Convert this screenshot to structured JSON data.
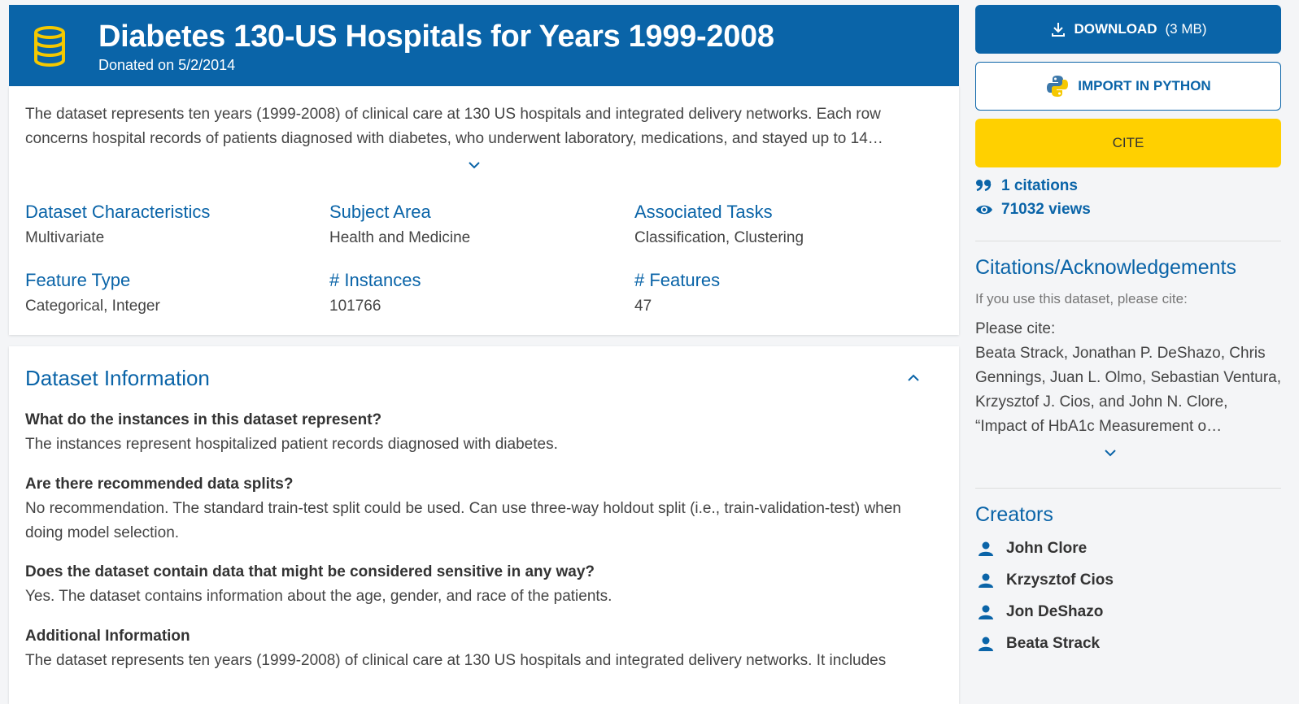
{
  "header": {
    "title": "Diabetes 130-US Hospitals for Years 1999-2008",
    "donated": "Donated on 5/2/2014"
  },
  "summary": {
    "description": "The dataset represents ten years (1999-2008) of clinical care at 130 US hospitals and integrated delivery networks. Each row concerns hospital records of patients diagnosed with diabetes, who underwent laboratory, medications, and stayed up to 14…",
    "characteristics_label": "Dataset Characteristics",
    "characteristics_value": "Multivariate",
    "subject_label": "Subject Area",
    "subject_value": "Health and Medicine",
    "tasks_label": "Associated Tasks",
    "tasks_value": "Classification, Clustering",
    "feature_type_label": "Feature Type",
    "feature_type_value": "Categorical, Integer",
    "instances_label": "# Instances",
    "instances_value": "101766",
    "features_label": "# Features",
    "features_value": "47"
  },
  "info": {
    "heading": "Dataset Information",
    "items": [
      {
        "q": "What do the instances in this dataset represent?",
        "a": "The instances represent hospitalized patient records diagnosed with diabetes."
      },
      {
        "q": "Are there recommended data splits?",
        "a": "No recommendation. The standard train-test split could be used. Can use three-way holdout split (i.e., train-validation-test) when doing model selection."
      },
      {
        "q": "Does the dataset contain data that might be considered sensitive in any way?",
        "a": "Yes. The dataset contains information about the age, gender, and race of the patients."
      },
      {
        "q": "Additional Information",
        "a": "The dataset represents ten years (1999-2008) of clinical care at 130 US hospitals and integrated delivery networks. It includes"
      }
    ]
  },
  "sidebar": {
    "download_label": "DOWNLOAD",
    "download_size": "(3 MB)",
    "import_label": "IMPORT IN PYTHON",
    "cite_label": "CITE",
    "citations": "1 citations",
    "views": "71032 views",
    "citations_heading": "Citations/Acknowledgements",
    "cite_hint": "If you use this dataset, please cite:",
    "please_cite": "Please cite:",
    "cite_text": "Beata Strack, Jonathan P. DeShazo, Chris Gennings, Juan L. Olmo, Sebastian Ventura, Krzysztof J. Cios, and John N. Clore, “Impact of HbA1c Measurement o…",
    "creators_heading": "Creators",
    "creators": [
      "John Clore",
      "Krzysztof Cios",
      "Jon DeShazo",
      "Beata Strack"
    ]
  },
  "colors": {
    "primary": "#0a64a8",
    "cite_button": "#ffd000",
    "db_icon": "#f5c800"
  },
  "icons": {
    "header": "database-icon",
    "download": "download-icon",
    "import": "python-icon",
    "citations": "quote-icon",
    "views": "eye-icon",
    "creator": "person-icon",
    "expand": "chevron-down-icon",
    "collapse": "chevron-up-icon"
  }
}
